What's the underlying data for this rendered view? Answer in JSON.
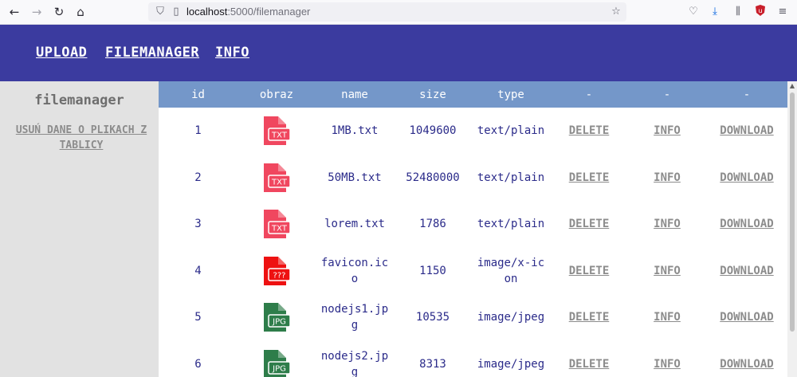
{
  "browser": {
    "url_host": "localhost",
    "url_rest": ":5000/filemanager"
  },
  "nav": {
    "upload": "UPLOAD",
    "filemanager": "FILEMANAGER",
    "info": "INFO"
  },
  "sidebar": {
    "title": "filemanager",
    "clear_link": "USUŃ DANE O PLIKACH Z TABLICY"
  },
  "table": {
    "headers": [
      "id",
      "obraz",
      "name",
      "size",
      "type",
      "-",
      "-",
      "-"
    ],
    "rows": [
      {
        "id": "1",
        "icon": "txt-file-icon",
        "icon_label": "TXT",
        "name": "1MB.txt",
        "size": "1049600",
        "type": "text/plain",
        "delete": "DELETE",
        "info": "INFO",
        "download": "DOWNLOAD"
      },
      {
        "id": "2",
        "icon": "txt-file-icon",
        "icon_label": "TXT",
        "name": "50MB.txt",
        "size": "52480000",
        "type": "text/plain",
        "delete": "DELETE",
        "info": "INFO",
        "download": "DOWNLOAD"
      },
      {
        "id": "3",
        "icon": "txt-file-icon",
        "icon_label": "TXT",
        "name": "lorem.txt",
        "size": "1786",
        "type": "text/plain",
        "delete": "DELETE",
        "info": "INFO",
        "download": "DOWNLOAD"
      },
      {
        "id": "4",
        "icon": "unknown-file-icon",
        "icon_label": "???",
        "name": "favicon.ico",
        "size": "1150",
        "type": "image/x-icon",
        "delete": "DELETE",
        "info": "INFO",
        "download": "DOWNLOAD"
      },
      {
        "id": "5",
        "icon": "jpg-file-icon",
        "icon_label": "JPG",
        "name": "nodejs1.jpg",
        "size": "10535",
        "type": "image/jpeg",
        "delete": "DELETE",
        "info": "INFO",
        "download": "DOWNLOAD"
      },
      {
        "id": "6",
        "icon": "jpg-file-icon",
        "icon_label": "JPG",
        "name": "nodejs2.jpg",
        "size": "8313",
        "type": "image/jpeg",
        "delete": "DELETE",
        "info": "INFO",
        "download": "DOWNLOAD"
      }
    ]
  },
  "colors": {
    "header_bg": "#3b3b9f",
    "table_header_bg": "#7497c9",
    "txt_icon": "#f0475f",
    "unknown_icon": "#ee1111",
    "jpg_icon": "#2e7d4a"
  }
}
